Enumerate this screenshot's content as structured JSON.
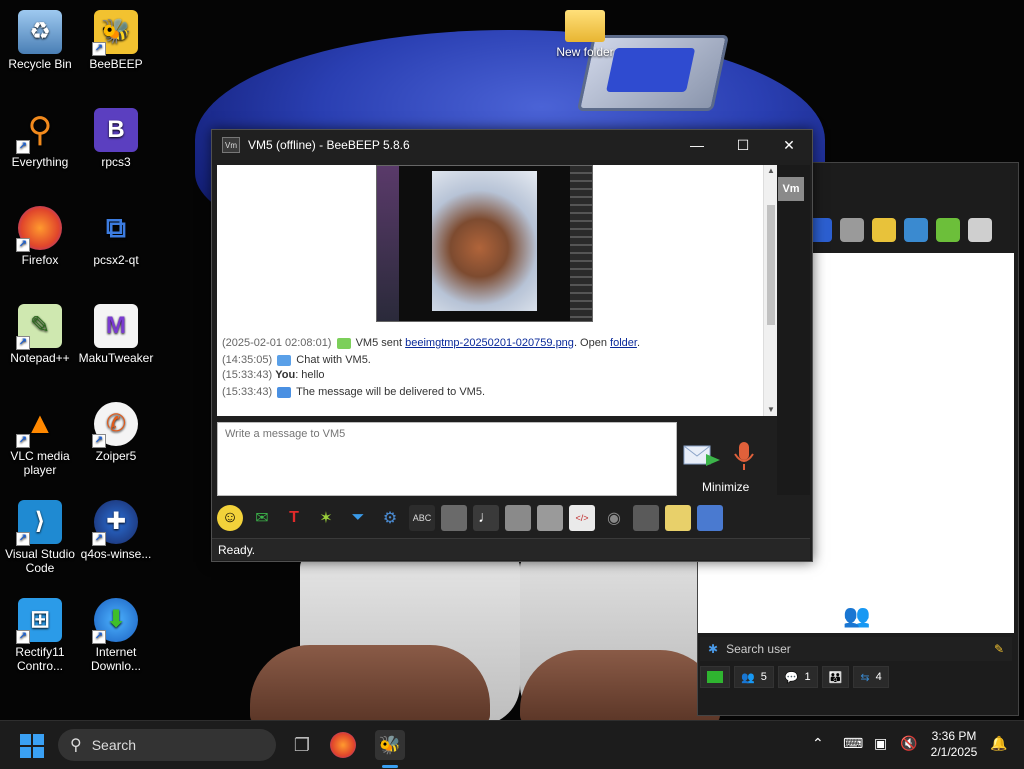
{
  "desktop": {
    "icons": [
      {
        "label": "Recycle Bin",
        "icon": "recycle-bin-icon"
      },
      {
        "label": "BeeBEEP",
        "icon": "bee-icon"
      },
      {
        "label": "Everything",
        "icon": "search-ring-icon"
      },
      {
        "label": "rpcs3",
        "icon": "rpcs3-icon"
      },
      {
        "label": "Firefox",
        "icon": "firefox-icon"
      },
      {
        "label": "pcsx2-qt",
        "icon": "pcsx2-icon"
      },
      {
        "label": "Notepad++",
        "icon": "notepad-icon"
      },
      {
        "label": "MakuTweaker",
        "icon": "makutweaker-icon"
      },
      {
        "label": "VLC media player",
        "icon": "vlc-cone-icon"
      },
      {
        "label": "Zoiper5",
        "icon": "zoiper-icon"
      },
      {
        "label": "Visual Studio Code",
        "icon": "vscode-icon"
      },
      {
        "label": "q4os-winse...",
        "icon": "q4os-icon"
      },
      {
        "label": "Rectify11 Contro...",
        "icon": "rectify11-icon"
      },
      {
        "label": "Internet Downlo...",
        "icon": "globe-download-icon"
      },
      {
        "label": "New folder",
        "icon": "folder-icon"
      }
    ]
  },
  "chat_window": {
    "title": "VM5 (offline) - BeeBEEP 5.8.6",
    "title_icon": "Vm",
    "caption": {
      "minimize": "—",
      "maximize": "☐",
      "close": "✕"
    },
    "messages": {
      "file": {
        "ts": "(2025-02-01 02:08:01)",
        "text1": "VM5 sent",
        "file_link": "beeimgtmp-20250201-020759.png",
        "text2": ". Open",
        "folder_link": "folder",
        "text3": "."
      },
      "chat": {
        "ts": "(14:35:05)",
        "text": "Chat with VM5."
      },
      "you": {
        "ts": "(15:33:43)",
        "sender": "You",
        "text": ": hello"
      },
      "notice": {
        "ts": "(15:33:43)",
        "text": "The message will be delivered to VM5."
      }
    },
    "input_placeholder": "Write a message to VM5",
    "minimize_label": "Minimize",
    "side_badge": "Vm",
    "status": "Ready."
  },
  "back_window": {
    "search_placeholder": "Search user",
    "counts": {
      "users": "5",
      "chats": "1",
      "groups": "",
      "shares": "4"
    }
  },
  "taskbar": {
    "search_label": "Search",
    "time": "3:36 PM",
    "date": "2/1/2025"
  },
  "colors": {
    "accent": "#3aa0f3",
    "link": "#0a2a9a"
  }
}
